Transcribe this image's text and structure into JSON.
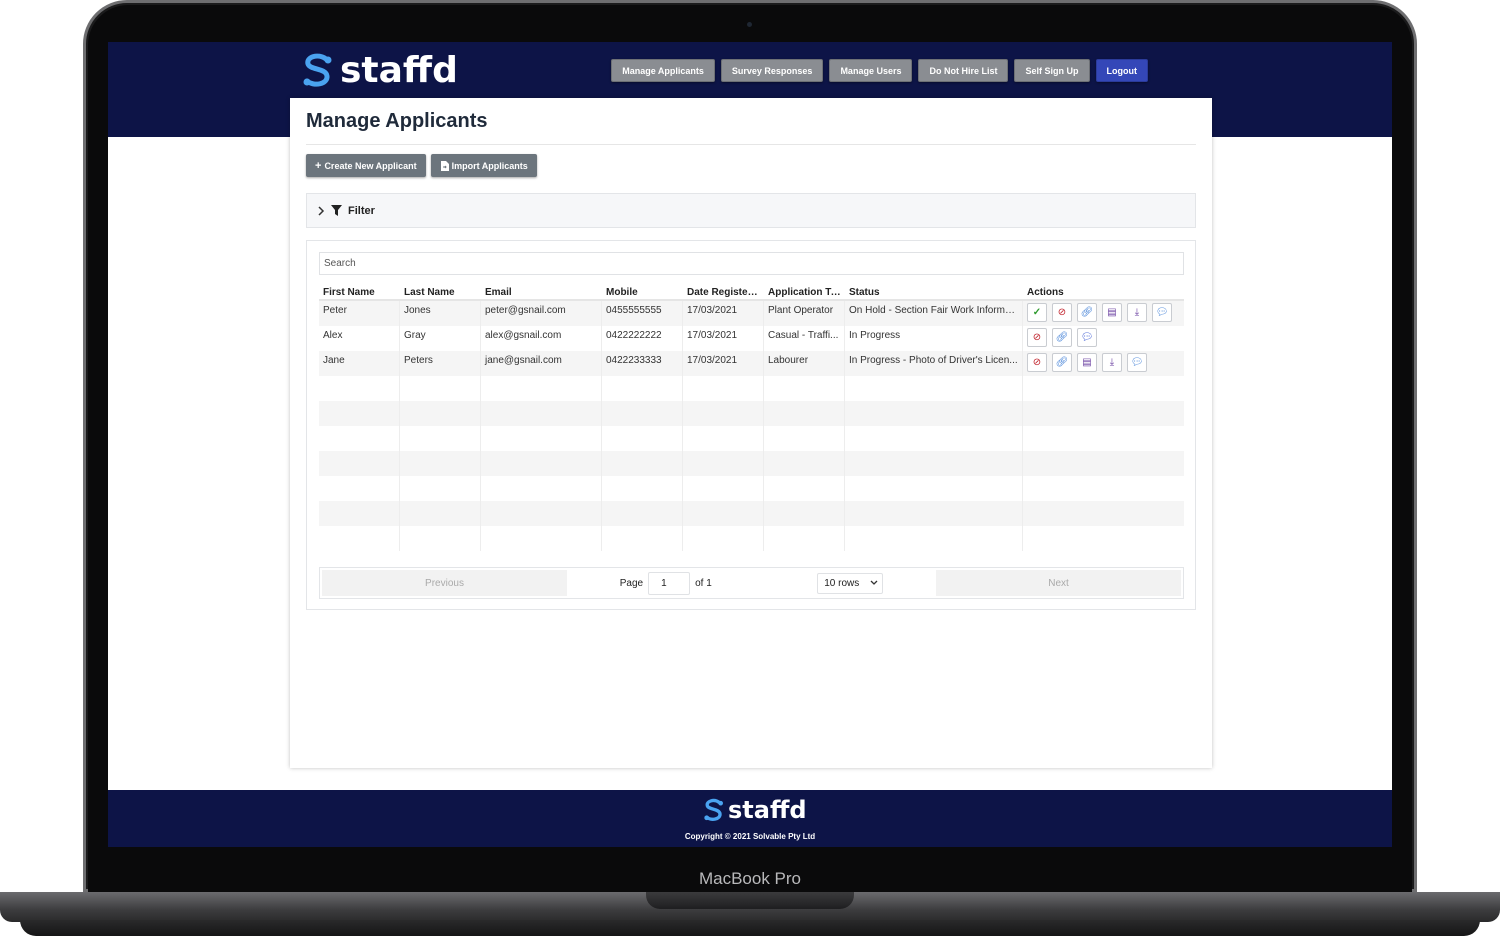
{
  "device": {
    "label": "MacBook Pro"
  },
  "brand": {
    "name": "staffd",
    "primary_color": "#0d1447",
    "accent_color": "#3447b8"
  },
  "nav": [
    {
      "label": "Manage Applicants"
    },
    {
      "label": "Survey Responses"
    },
    {
      "label": "Manage Users"
    },
    {
      "label": "Do Not Hire List"
    },
    {
      "label": "Self Sign Up"
    },
    {
      "label": "Logout"
    }
  ],
  "page": {
    "title": "Manage Applicants",
    "create_label": "Create New Applicant",
    "import_label": "Import Applicants",
    "filter_label": "Filter"
  },
  "table": {
    "search_placeholder": "Search",
    "columns": [
      "First Name",
      "Last Name",
      "Email",
      "Mobile",
      "Date Registered",
      "Application Ty...",
      "Status",
      "Actions"
    ],
    "rows": [
      {
        "first": "Peter",
        "last": "Jones",
        "email": "peter@gsnail.com",
        "mobile": "0455555555",
        "date": "17/03/2021",
        "type": "Plant Operator",
        "status": "On Hold - Section Fair Work Informa..."
      },
      {
        "first": "Alex",
        "last": "Gray",
        "email": "alex@gsnail.com",
        "mobile": "0422222222",
        "date": "17/03/2021",
        "type": "Casual - Traffi...",
        "status": "In Progress"
      },
      {
        "first": "Jane",
        "last": "Peters",
        "email": "jane@gsnail.com",
        "mobile": "0422233333",
        "date": "17/03/2021",
        "type": "Labourer",
        "status": "In Progress - Photo of Driver's Licen..."
      }
    ]
  },
  "pager": {
    "previous": "Previous",
    "page_label": "Page",
    "page_value": "1",
    "of_label": "of 1",
    "rows_option": "10 rows",
    "next": "Next"
  },
  "footer": {
    "copyright": "Copyright © 2021 Solvable Pty Ltd"
  }
}
